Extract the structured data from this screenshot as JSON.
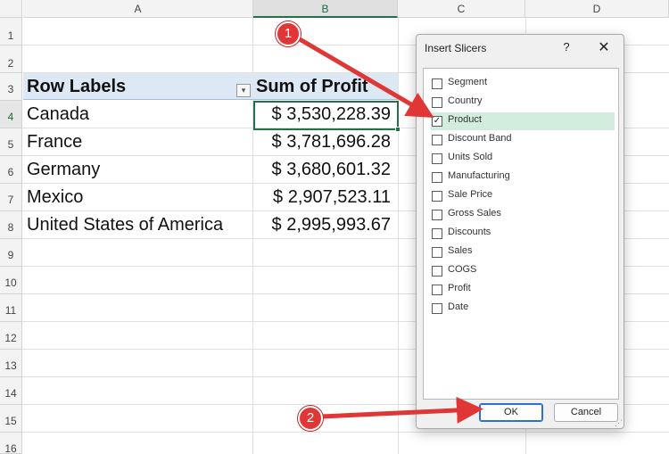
{
  "sheet": {
    "columns": [
      "A",
      "B",
      "C",
      "D"
    ],
    "rows": [
      "1",
      "2",
      "3",
      "4",
      "5",
      "6",
      "7",
      "8",
      "9",
      "10",
      "11",
      "12",
      "13",
      "14",
      "15",
      "16"
    ],
    "pivot": {
      "header_row_labels": "Row Labels",
      "header_value": "Sum of Profit",
      "filter_icon": "filter-dropdown-icon",
      "rows": [
        {
          "label": "Canada",
          "value": "$ 3,530,228.39"
        },
        {
          "label": "France",
          "value": "$ 3,781,696.28"
        },
        {
          "label": "Germany",
          "value": "$ 3,680,601.32"
        },
        {
          "label": "Mexico",
          "value": "$ 2,907,523.11"
        },
        {
          "label": "United States of America",
          "value": "$ 2,995,993.67"
        }
      ]
    }
  },
  "dialog": {
    "title": "Insert Slicers",
    "help_label": "?",
    "close_label": "✕",
    "options": [
      {
        "label": "Segment",
        "checked": false
      },
      {
        "label": "Country",
        "checked": false
      },
      {
        "label": "Product",
        "checked": true
      },
      {
        "label": "Discount Band",
        "checked": false
      },
      {
        "label": "Units Sold",
        "checked": false
      },
      {
        "label": "Manufacturing",
        "checked": false
      },
      {
        "label": "Sale Price",
        "checked": false
      },
      {
        "label": "Gross Sales",
        "checked": false
      },
      {
        "label": "Discounts",
        "checked": false
      },
      {
        "label": "Sales",
        "checked": false
      },
      {
        "label": "COGS",
        "checked": false
      },
      {
        "label": "Profit",
        "checked": false
      },
      {
        "label": "Date",
        "checked": false
      }
    ],
    "ok_label": "OK",
    "cancel_label": "Cancel"
  },
  "annotations": {
    "step1": "1",
    "step2": "2",
    "color": "#e03636"
  }
}
